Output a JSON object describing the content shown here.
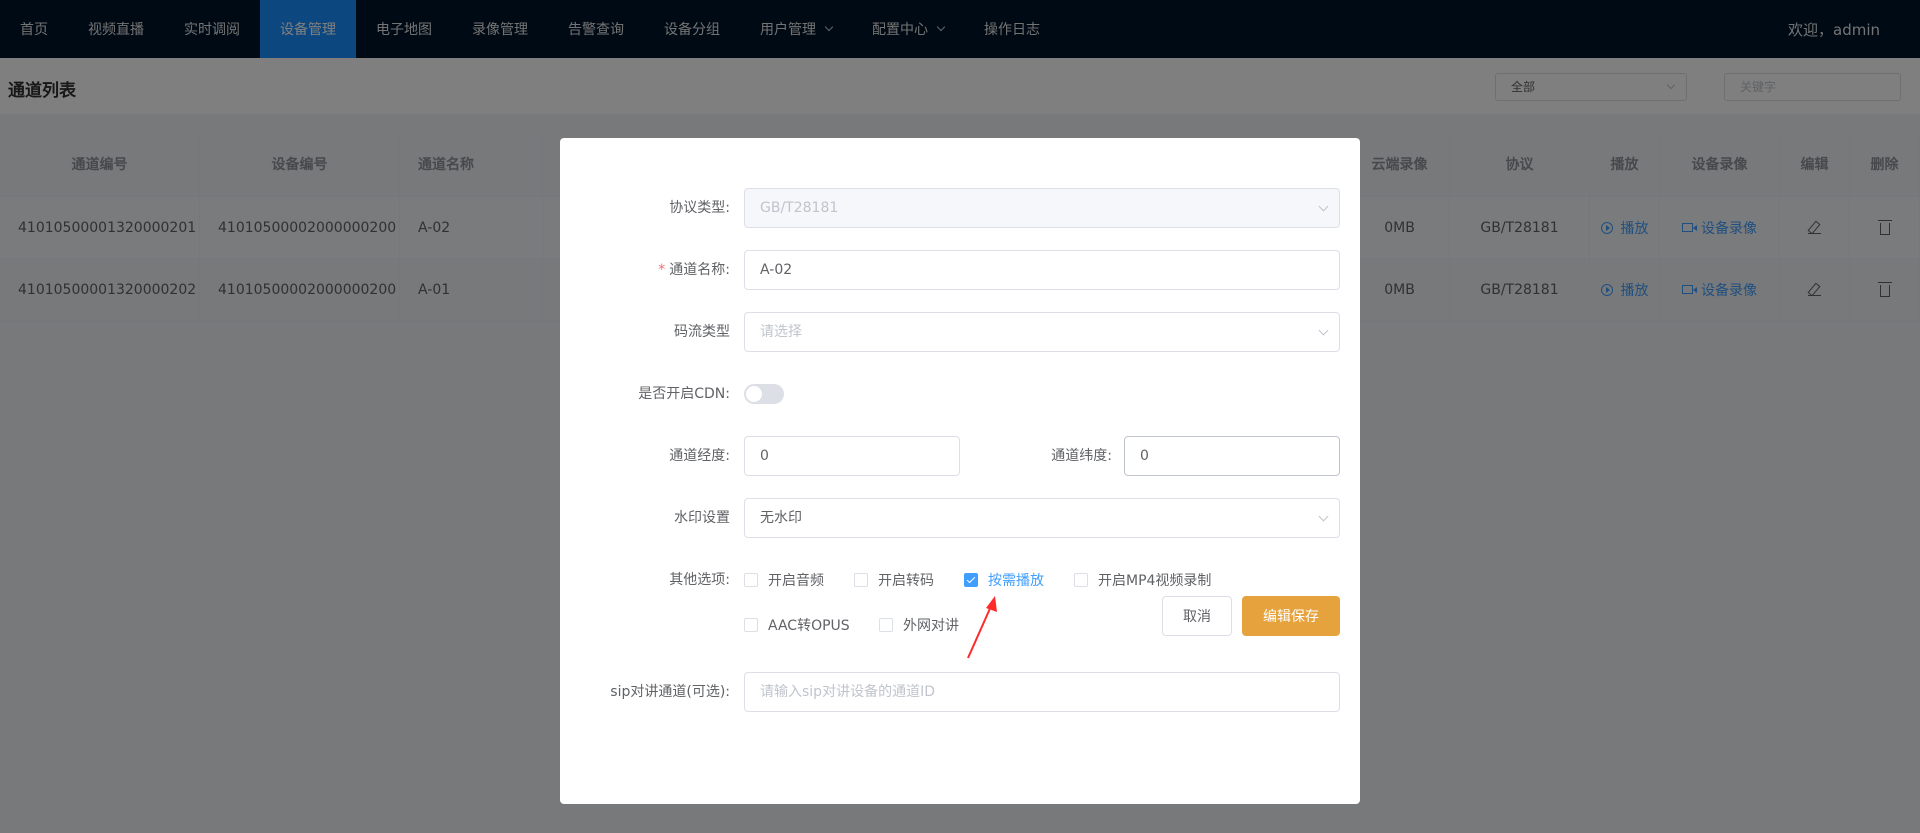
{
  "nav": {
    "items": [
      {
        "label": "首页"
      },
      {
        "label": "视频直播"
      },
      {
        "label": "实时调阅"
      },
      {
        "label": "设备管理"
      },
      {
        "label": "电子地图"
      },
      {
        "label": "录像管理"
      },
      {
        "label": "告警查询"
      },
      {
        "label": "设备分组"
      },
      {
        "label": "用户管理"
      },
      {
        "label": "配置中心"
      },
      {
        "label": "操作日志"
      }
    ],
    "active": "设备管理",
    "user": "欢迎，admin"
  },
  "page": {
    "title": "通道列表",
    "filter_value": "全部",
    "keyword_placeholder": "关键字"
  },
  "table": {
    "headers": {
      "channel_id": "通道编号",
      "device_id": "设备编号",
      "channel_name": "通道名称",
      "cloud_record": "云端录像",
      "protocol": "协议",
      "play": "播放",
      "device_record": "设备录像",
      "edit": "编辑",
      "delete": "删除"
    },
    "rows": [
      {
        "channel_id": "41010500001320000201",
        "device_id": "41010500002000000200",
        "channel_name": "A-02",
        "cloud_record": "0MB",
        "protocol": "GB/T28181",
        "play": "播放",
        "device_record": "设备录像"
      },
      {
        "channel_id": "41010500001320000202",
        "device_id": "41010500002000000200",
        "channel_name": "A-01",
        "cloud_record": "0MB",
        "protocol": "GB/T28181",
        "play": "播放",
        "device_record": "设备录像"
      }
    ]
  },
  "dialog": {
    "protocol_label": "协议类型:",
    "protocol_value": "GB/T28181",
    "name_label": "通道名称:",
    "name_required": "*",
    "name_value": "A-02",
    "stream_label": "码流类型",
    "stream_placeholder": "请选择",
    "cdn_label": "是否开启CDN:",
    "cdn_enabled": false,
    "lng_label": "通道经度:",
    "lng_value": "0",
    "lat_label": "通道纬度:",
    "lat_value": "0",
    "watermark_label": "水印设置",
    "watermark_value": "无水印",
    "options_label": "其他选项:",
    "options": [
      {
        "label": "开启音频",
        "checked": false
      },
      {
        "label": "开启转码",
        "checked": false
      },
      {
        "label": "按需播放",
        "checked": true
      },
      {
        "label": "开启MP4视频录制",
        "checked": false
      },
      {
        "label": "AAC转OPUS",
        "checked": false
      },
      {
        "label": "外网对讲",
        "checked": false
      }
    ],
    "sip_label": "sip对讲通道(可选):",
    "sip_placeholder": "请输入sip对讲设备的通道ID",
    "cancel": "取消",
    "save": "编辑保存"
  },
  "colors": {
    "nav_bg": "#001529",
    "nav_active": "#1890ff",
    "primary": "#409eff",
    "save_button": "#e6a23c",
    "arrow": "#ff2a2a"
  }
}
